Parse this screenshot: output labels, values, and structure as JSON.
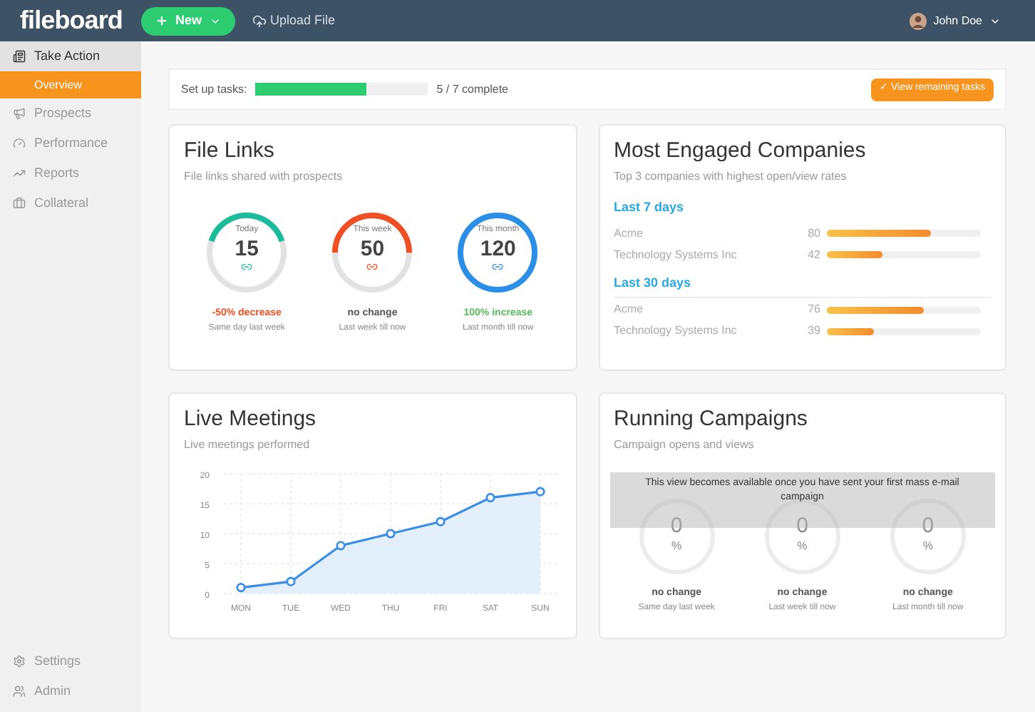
{
  "topbar": {
    "logo": "fileboard",
    "new_button": "New",
    "upload": "Upload File",
    "user": "John Doe"
  },
  "sidebar": {
    "items": [
      {
        "label": "Take Action",
        "kind": "section",
        "selected": false,
        "children": [
          {
            "label": "Overview",
            "selected": true
          }
        ]
      },
      {
        "label": "Prospects",
        "kind": "item",
        "selected": false
      },
      {
        "label": "Performance",
        "kind": "item",
        "selected": false
      },
      {
        "label": "Reports",
        "kind": "item",
        "selected": false
      },
      {
        "label": "Collateral",
        "kind": "item",
        "selected": false
      }
    ],
    "bottom_items": [
      {
        "label": "Settings"
      },
      {
        "label": "Admin"
      }
    ]
  },
  "setup": {
    "label": "Set up tasks:",
    "level": 0.64,
    "reading": "5 / 7 complete",
    "button": "✓ View remaining tasks"
  },
  "file_links": {
    "title": "File Links",
    "subtitle": "File links shared with prospects",
    "gauges": [
      {
        "label": "Today",
        "value": "15",
        "level": 0.4,
        "color": "#1abc9c",
        "change": {
          "text": "-50% decrease",
          "color": "#f04e23"
        },
        "note": "Same day last week"
      },
      {
        "label": "This week",
        "value": "50",
        "level": 0.5,
        "color": "#f04e23",
        "change": {
          "text": "no change",
          "color": "#555555"
        },
        "note": "Last week till now"
      },
      {
        "label": "This month",
        "value": "120",
        "level": 1,
        "color": "#2b8fe8",
        "change": {
          "text": "100% increase",
          "color": "#5cb85c"
        },
        "note": "Last month till now"
      }
    ]
  },
  "engaged": {
    "title": "Most Engaged Companies",
    "subtitle": "Top 3 companies with highest open/view rates",
    "groups": [
      {
        "title": "Last 7 days",
        "rows": [
          {
            "name": "Acme",
            "value": "80",
            "level": 0.68
          },
          {
            "name": "Technology Systems Inc",
            "value": "42",
            "level": 0.37
          }
        ]
      },
      {
        "title": "Last 30 days",
        "rows": [
          {
            "name": "Acme",
            "value": "76",
            "level": 0.63
          },
          {
            "name": "Technology Systems Inc",
            "value": "39",
            "level": 0.31
          }
        ]
      }
    ]
  },
  "meetings": {
    "title": "Live Meetings",
    "subtitle": "Live meetings performed",
    "chart_data": {
      "type": "area",
      "categories": [
        "MON",
        "TUE",
        "WED",
        "THU",
        "FRI",
        "SAT",
        "SUN"
      ],
      "values": [
        1,
        2,
        8,
        10,
        12,
        16,
        17
      ],
      "ylim": [
        0,
        20
      ],
      "yticks": [
        0,
        5,
        10,
        15,
        20
      ],
      "grid": true
    }
  },
  "campaigns": {
    "title": "Running Campaigns",
    "subtitle": "Campaign opens and views",
    "overlay": "This view becomes available once you have sent your first mass e-mail campaign",
    "gauges": [
      {
        "value": "0",
        "unit": "%",
        "change": "no change",
        "note": "Same day last week"
      },
      {
        "value": "0",
        "unit": "%",
        "change": "no change",
        "note": "Last week till now"
      },
      {
        "value": "0",
        "unit": "%",
        "change": "no change",
        "note": "Last month till now"
      }
    ]
  }
}
